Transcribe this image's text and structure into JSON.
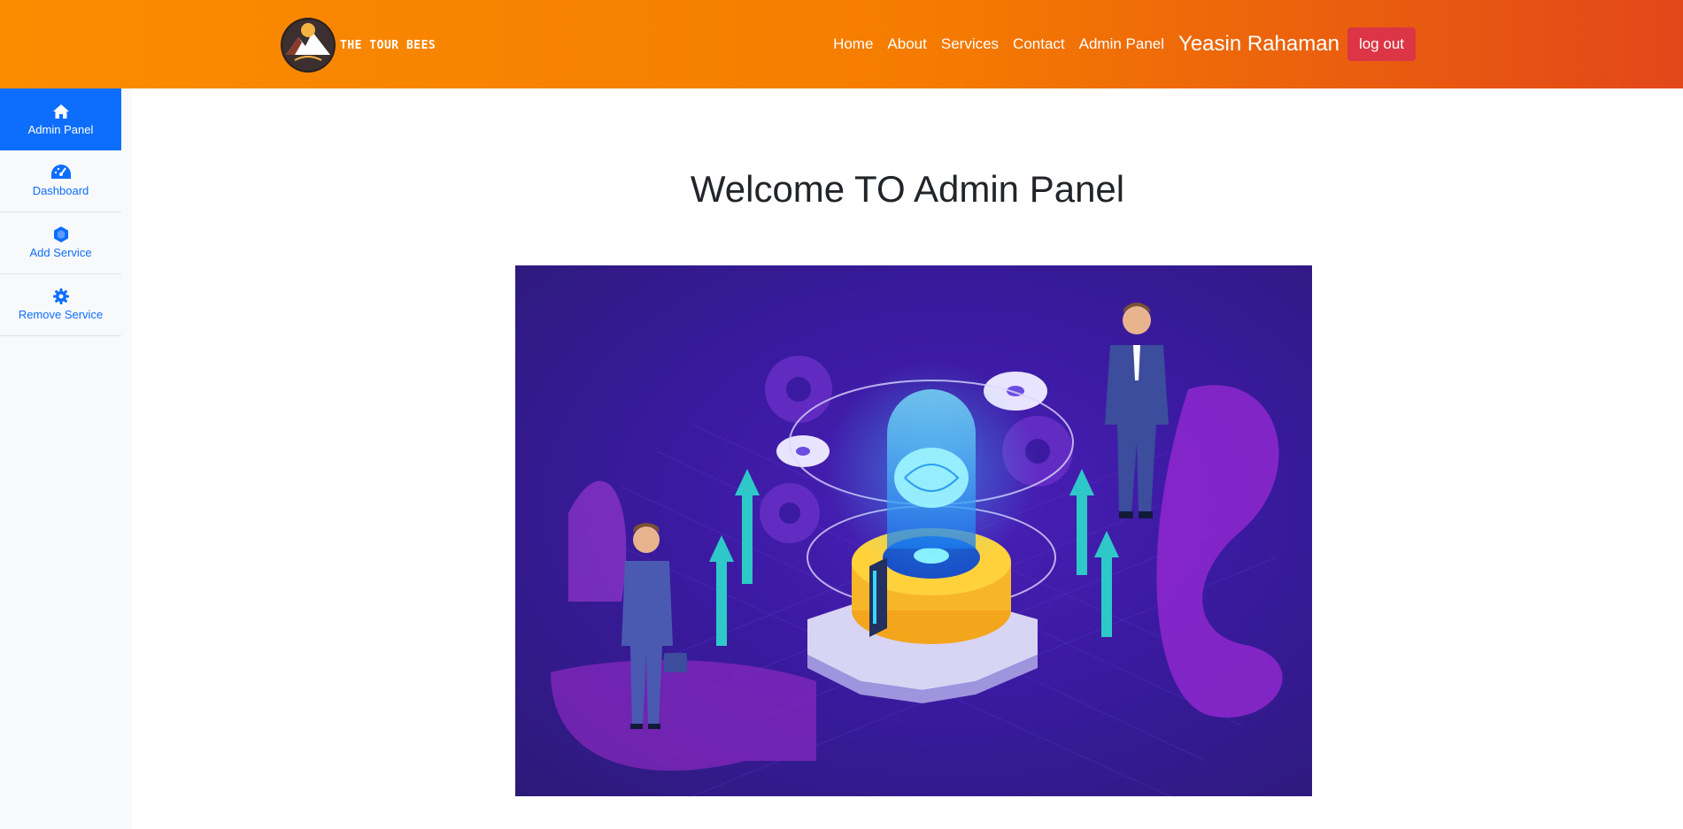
{
  "header": {
    "brand_text": "THE TOUR BEES",
    "nav": [
      "Home",
      "About",
      "Services",
      "Contact",
      "Admin Panel"
    ],
    "user_name": "Yeasin Rahaman",
    "logout_label": "log out"
  },
  "sidebar": {
    "items": [
      {
        "label": "Admin Panel",
        "icon": "home-icon",
        "active": true
      },
      {
        "label": "Dashboard",
        "icon": "tachometer-icon",
        "active": false
      },
      {
        "label": "Add Service",
        "icon": "cube-icon",
        "active": false
      },
      {
        "label": "Remove Service",
        "icon": "gear-icon",
        "active": false
      }
    ]
  },
  "main": {
    "title": "Welcome TO Admin Panel"
  },
  "colors": {
    "header_start": "#fb8c00",
    "header_end": "#e2471a",
    "primary": "#0d6efd",
    "danger": "#dc3545",
    "hero_bg": "#3a1aa0"
  }
}
